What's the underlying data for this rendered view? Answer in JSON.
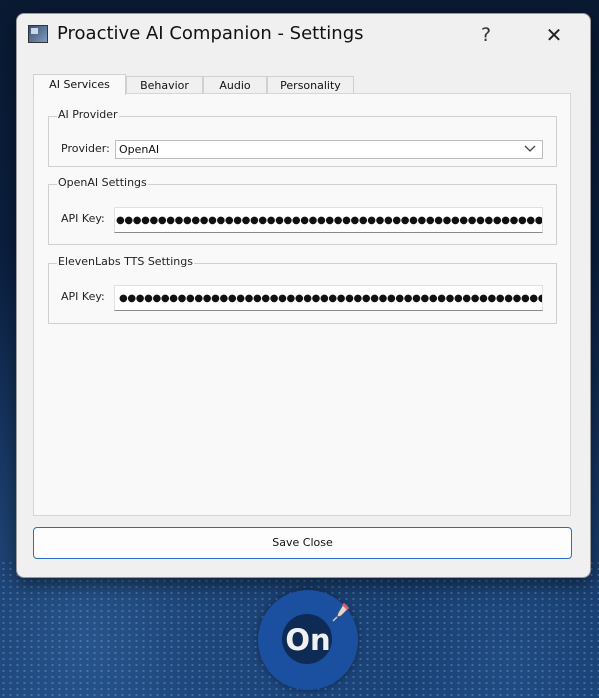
{
  "window": {
    "title": "Proactive AI Companion - Settings",
    "help_label": "?",
    "close_label": "✕"
  },
  "tabs": [
    {
      "label": "AI  Services",
      "active": true
    },
    {
      "label": "Behavior",
      "active": false
    },
    {
      "label": "Audio",
      "active": false
    },
    {
      "label": "Personality",
      "active": false
    }
  ],
  "ai_provider": {
    "group_title": "AI Provider",
    "provider_label": "Provider:",
    "provider_value": "OpenAI"
  },
  "openai_settings": {
    "group_title": "OpenAI Settings",
    "api_key_label": "API Key:",
    "api_key_masked": "●●●●●●●●●●●●●●●●●●●●●●●●●●●●●●●●●●●●●●●●●●●●●●●●●●●●●●●●●●●●●●●●●●●●●●"
  },
  "elevenlabs_settings": {
    "group_title": "ElevenLabs TTS Settings",
    "api_key_label": "API Key:",
    "api_key_masked": "●●●●●●●●●●●●●●●●●●●●●●●●●●●●●●●●●●●●●●●●●●●●●●●●●●●●●●●"
  },
  "footer": {
    "save_close_label": "Save  Close"
  },
  "toggle": {
    "label": "On",
    "icon": "microphone-icon"
  },
  "colors": {
    "accent": "#2a6ec2",
    "toggle_blue": "#1b4f9f",
    "window_bg": "#f0f0f0"
  }
}
